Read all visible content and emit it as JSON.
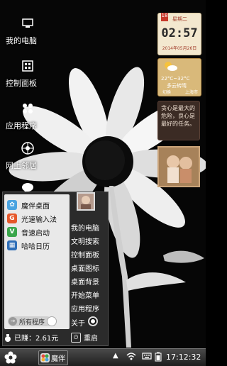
{
  "desktop": {
    "icons": [
      {
        "label": "我的电脑",
        "icon": "computer-icon"
      },
      {
        "label": "控制面板",
        "icon": "control-panel-icon"
      },
      {
        "label": "应用程序",
        "icon": "apps-icon"
      },
      {
        "label": "网上邻居",
        "icon": "network-icon"
      },
      {
        "label": "",
        "icon": "chat-icon"
      }
    ]
  },
  "widgets": {
    "clock": {
      "badge": "18",
      "weekday": "星期二",
      "time": "02:57",
      "date": "2014年05月26日"
    },
    "weather": {
      "temp": "22°C~32°C",
      "condition": "多云转晴",
      "city": "上海市",
      "change": "切换"
    },
    "note": {
      "text": "贪心是最大的危险，良心是最好的任务。"
    }
  },
  "start_menu": {
    "apps": [
      {
        "label": "魔伴桌面",
        "icon": "mobao-icon",
        "color": "#4aa3e0"
      },
      {
        "label": "光速输入法",
        "icon": "input-method-icon",
        "color": "#e6582a"
      },
      {
        "label": "音速启动",
        "icon": "launcher-icon",
        "color": "#3aa64a"
      },
      {
        "label": "哈哈日历",
        "icon": "calendar-icon",
        "color": "#2f6fb8"
      }
    ],
    "all_programs": "所有程序",
    "right_items": [
      "我的电脑",
      "文明搜索",
      "控制面板",
      "桌面图标",
      "桌面背景",
      "开始菜单",
      "应用程序"
    ],
    "shutdown_label": "关于",
    "earned": "已赚：2.61元",
    "restart": "重启"
  },
  "taskbar": {
    "task_label": "魔伴",
    "time": "17:12:32"
  },
  "colors": {
    "taskbar": "#2a2a2a",
    "menu_bg": "#2b2b2b",
    "menu_left": "#e9e9e9"
  }
}
